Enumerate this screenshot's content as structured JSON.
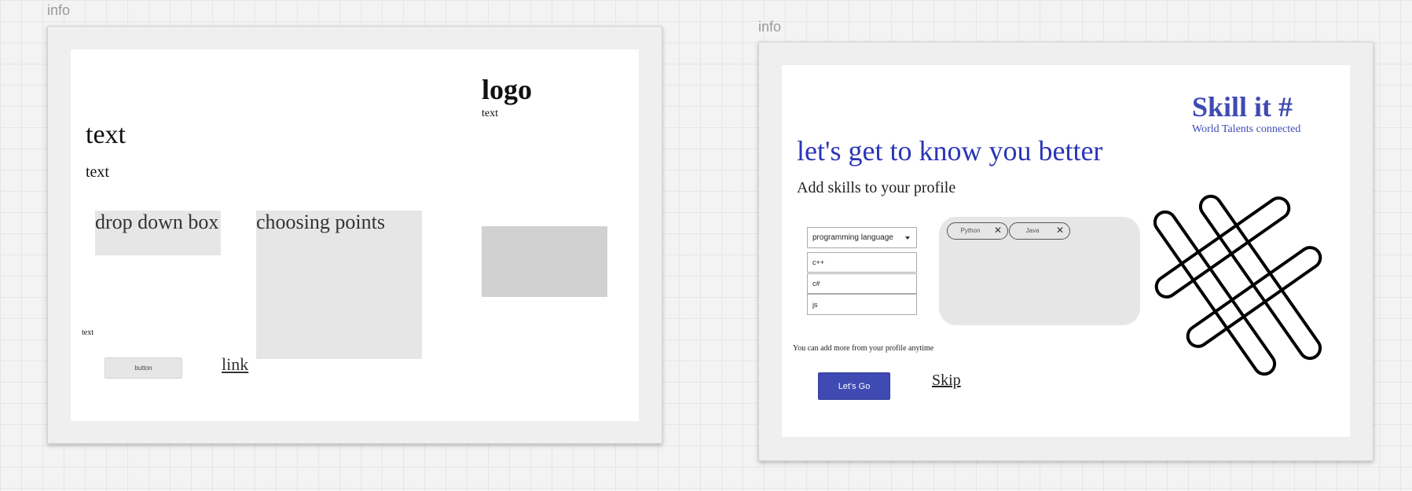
{
  "wireframe": {
    "frame_label": "info",
    "logo": "logo",
    "logo_subtext": "text",
    "title_text": "text",
    "subtitle_text": "text",
    "dropdown_box": "drop down box",
    "choosing_points": "choosing points",
    "small_text": "text",
    "button": "button",
    "link": "link"
  },
  "mockup": {
    "frame_label": "info",
    "brand": {
      "title": "Skill it #",
      "tagline": "World Talents connected"
    },
    "heading": "let's get to know you better",
    "subheading": "Add skills to your profile",
    "dropdown": {
      "selected": "programming language",
      "options": [
        "c++",
        "c#",
        "js"
      ]
    },
    "chips": [
      {
        "label": "Python"
      },
      {
        "label": "Java"
      }
    ],
    "note": "You can add more from your profile anytime",
    "primary_button": "Let's Go",
    "skip_link": "Skip",
    "accent_color": "#3f4ab3",
    "heading_color": "#2a35b8",
    "icons": [
      "chevron-down-icon",
      "close-icon",
      "hashtag-icon"
    ]
  }
}
